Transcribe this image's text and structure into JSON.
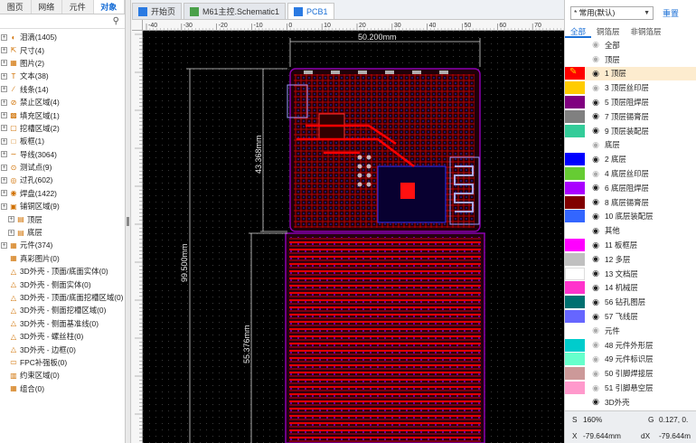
{
  "left_panel": {
    "tabs": [
      "图页",
      "网络",
      "元件",
      "对象"
    ],
    "active_tab": "对象",
    "search_placeholder": "",
    "items": [
      {
        "label": "泪滴(1405)",
        "icon": "teardrop-icon",
        "expandable": true
      },
      {
        "label": "尺寸(4)",
        "icon": "dimension-icon",
        "expandable": true
      },
      {
        "label": "图片(2)",
        "icon": "image-icon",
        "expandable": true
      },
      {
        "label": "文本(38)",
        "icon": "text-icon",
        "expandable": true
      },
      {
        "label": "线条(14)",
        "icon": "line-icon",
        "expandable": true
      },
      {
        "label": "禁止区域(4)",
        "icon": "keepout-icon",
        "expandable": true
      },
      {
        "label": "填充区域(1)",
        "icon": "fill-region-icon",
        "expandable": true
      },
      {
        "label": "挖槽区域(2)",
        "icon": "slot-region-icon",
        "expandable": true
      },
      {
        "label": "板框(1)",
        "icon": "board-outline-icon",
        "expandable": true
      },
      {
        "label": "导线(3064)",
        "icon": "track-icon",
        "expandable": true
      },
      {
        "label": "测试点(9)",
        "icon": "testpoint-icon",
        "expandable": true
      },
      {
        "label": "过孔(602)",
        "icon": "via-icon",
        "expandable": true
      },
      {
        "label": "焊盘(1422)",
        "icon": "pad-icon",
        "expandable": true
      },
      {
        "label": "铺铜区域(9)",
        "icon": "copper-pour-icon",
        "expandable": true
      },
      {
        "label": "顶层",
        "icon": "folder-icon",
        "expandable": true,
        "sub": true
      },
      {
        "label": "底层",
        "icon": "folder-icon",
        "expandable": true,
        "sub": true
      },
      {
        "label": "元件(374)",
        "icon": "component-icon",
        "expandable": true
      },
      {
        "label": "真彩图片(0)",
        "icon": "truecolor-image-icon",
        "expandable": false
      },
      {
        "label": "3D外壳 - 顶面/底面实体(0)",
        "icon": "shell-icon",
        "expandable": false
      },
      {
        "label": "3D外壳 - 侧面实体(0)",
        "icon": "shell-icon",
        "expandable": false
      },
      {
        "label": "3D外壳 - 顶面/底面挖槽区域(0)",
        "icon": "shell-icon",
        "expandable": false
      },
      {
        "label": "3D外壳 - 侧面挖槽区域(0)",
        "icon": "shell-icon",
        "expandable": false
      },
      {
        "label": "3D外壳 - 侧面基准线(0)",
        "icon": "shell-icon",
        "expandable": false
      },
      {
        "label": "3D外壳 - 螺丝柱(0)",
        "icon": "shell-icon",
        "expandable": false
      },
      {
        "label": "3D外壳 - 边框(0)",
        "icon": "shell-icon",
        "expandable": false
      },
      {
        "label": "FPC补强板(0)",
        "icon": "fpc-icon",
        "expandable": false
      },
      {
        "label": "约束区域(0)",
        "icon": "constraint-icon",
        "expandable": false
      },
      {
        "label": "组合(0)",
        "icon": "group-icon",
        "expandable": false
      }
    ]
  },
  "doc_tabs": [
    {
      "label": "开始页",
      "icon": "home-icon",
      "active": false
    },
    {
      "label": "M61主控.Schematic1",
      "icon": "schematic-icon",
      "active": false
    },
    {
      "label": "PCB1",
      "icon": "pcb-icon",
      "active": true
    }
  ],
  "canvas": {
    "ruler_top_labels": [
      "-40",
      "-30",
      "-20",
      "-10",
      "0",
      "10",
      "20",
      "30",
      "40",
      "50",
      "60",
      "70"
    ],
    "dim_width": "50.200mm",
    "dim_height_total": "99.500mm",
    "dim_height_top": "43.368mm",
    "dim_height_bottom": "55.376mm"
  },
  "right_panel": {
    "preset_select": "* 常用(默认)",
    "reset_label": "重置",
    "filter_tabs": [
      "全部",
      "铜箔层",
      "非铜箔层"
    ],
    "active_filter": "全部",
    "layers": [
      {
        "label": "全部",
        "color": "",
        "eye": "dim",
        "group": false
      },
      {
        "label": "顶层",
        "color": "",
        "eye": "dim",
        "group": true
      },
      {
        "label": "1 顶层",
        "color": "#ff0000",
        "eye": "on",
        "group": false,
        "selected": true
      },
      {
        "label": "3 顶层丝印层",
        "color": "#ffcc00",
        "eye": "dim",
        "group": false
      },
      {
        "label": "5 顶层阻焊层",
        "color": "#800080",
        "eye": "on",
        "group": false
      },
      {
        "label": "7 顶层锡膏层",
        "color": "#808080",
        "eye": "on",
        "group": false
      },
      {
        "label": "9 顶层装配层",
        "color": "#33cc99",
        "eye": "on",
        "group": false
      },
      {
        "label": "底层",
        "color": "",
        "eye": "dim",
        "group": true
      },
      {
        "label": "2 底层",
        "color": "#0000ff",
        "eye": "on",
        "group": false
      },
      {
        "label": "4 底层丝印层",
        "color": "#66cc33",
        "eye": "dim",
        "group": false
      },
      {
        "label": "6 底层阻焊层",
        "color": "#aa00ff",
        "eye": "on",
        "group": false
      },
      {
        "label": "8 底层锡膏层",
        "color": "#800000",
        "eye": "on",
        "group": false
      },
      {
        "label": "10 底层装配层",
        "color": "#3366ff",
        "eye": "on",
        "group": false
      },
      {
        "label": "其他",
        "color": "",
        "eye": "on",
        "group": true
      },
      {
        "label": "11 板框层",
        "color": "#ff00ff",
        "eye": "on",
        "group": false
      },
      {
        "label": "12 多层",
        "color": "#c0c0c0",
        "eye": "on",
        "group": false
      },
      {
        "label": "13 文档层",
        "color": "#ffffff",
        "eye": "on",
        "group": false
      },
      {
        "label": "14 机械层",
        "color": "#ff33cc",
        "eye": "on",
        "group": false
      },
      {
        "label": "56 钻孔图层",
        "color": "#007070",
        "eye": "on",
        "group": false
      },
      {
        "label": "57 飞线层",
        "color": "#6666ff",
        "eye": "on",
        "group": false
      },
      {
        "label": "元件",
        "color": "",
        "eye": "dim",
        "group": true
      },
      {
        "label": "48 元件外形层",
        "color": "#00cccc",
        "eye": "dim",
        "group": false
      },
      {
        "label": "49 元件标识层",
        "color": "#66ffcc",
        "eye": "dim",
        "group": false
      },
      {
        "label": "50 引脚焊接层",
        "color": "#cc9999",
        "eye": "dim",
        "group": false
      },
      {
        "label": "51 引脚悬空层",
        "color": "#ff99cc",
        "eye": "dim",
        "group": false
      },
      {
        "label": "3D外壳",
        "color": "",
        "eye": "on",
        "group": true
      }
    ],
    "status": {
      "s_label": "S",
      "s_value": "160%",
      "g_label": "G",
      "g_value": "0.127, 0.",
      "x_label": "X",
      "x_value": "-79.644mm",
      "dx_label": "dX",
      "dx_value": "-79.644m"
    }
  }
}
